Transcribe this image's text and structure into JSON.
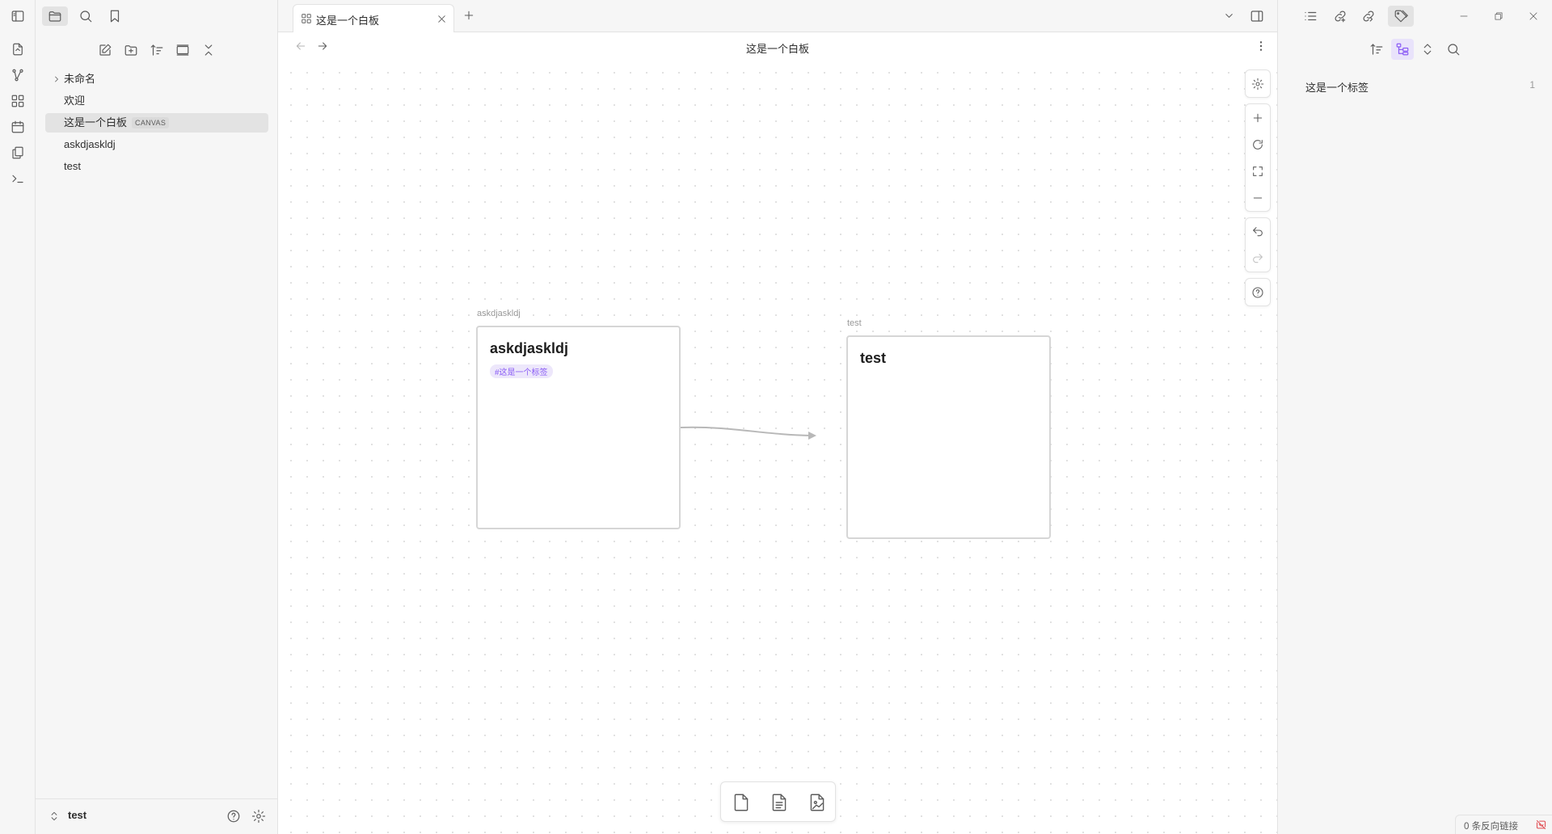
{
  "tab": {
    "title": "这是一个白板"
  },
  "view": {
    "title": "这是一个白板"
  },
  "file_tree": {
    "items": [
      {
        "label": "未命名",
        "type": "folder"
      },
      {
        "label": "欢迎",
        "type": "file"
      },
      {
        "label": "这是一个白板",
        "type": "file",
        "badge": "CANVAS",
        "active": true
      },
      {
        "label": "askdjaskldj",
        "type": "file"
      },
      {
        "label": "test",
        "type": "file"
      }
    ]
  },
  "vault": {
    "name": "test"
  },
  "canvas": {
    "nodes": [
      {
        "label": "askdjaskldj",
        "heading": "askdjaskldj",
        "tag": "#这是一个标签"
      },
      {
        "label": "test",
        "heading": "test"
      }
    ],
    "edges": [
      {
        "from": "askdjaskldj",
        "to": "test"
      }
    ]
  },
  "tags_panel": {
    "tags": [
      {
        "name": "这是一个标签",
        "count": "1"
      }
    ]
  },
  "status_bar": {
    "backlinks": "0 条反向链接"
  },
  "colors": {
    "accent": "#8a5cf5",
    "tag_bg": "#ede7fb",
    "sidebar_bg": "#f6f6f6",
    "border": "#e3e3e3"
  }
}
